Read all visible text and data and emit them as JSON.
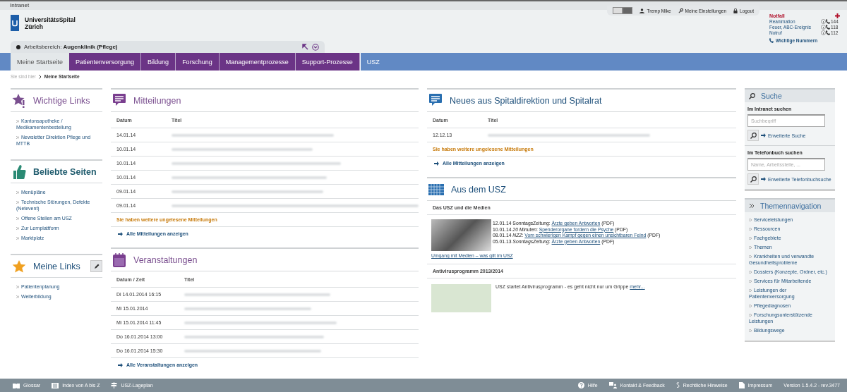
{
  "window": {
    "title": "Intranet"
  },
  "logo": {
    "line1": "UniversitätsSpital",
    "line2": "Zürich"
  },
  "workspace": {
    "label": "Arbeitsbereich:",
    "value": "Augenklinik (Pflege)"
  },
  "view_toggle": [
    {
      "selected": false
    },
    {
      "selected": true
    }
  ],
  "user_menu": [
    {
      "kind": "user",
      "label": "Tremp Mike"
    },
    {
      "kind": "settings",
      "label": "Meine Einstellungen"
    },
    {
      "kind": "logout",
      "label": "Logout"
    }
  ],
  "emergency": {
    "title": "Notfall",
    "items": [
      {
        "label": "Reanimation",
        "number": "144"
      },
      {
        "label": "Feuer, ABC-Ereignis",
        "number": "118"
      },
      {
        "label": "Notruf",
        "number": "112"
      }
    ],
    "link": "Wichtige Nummern"
  },
  "nav": [
    {
      "label": "Meine Startseite",
      "kind": "home",
      "selected": true
    },
    {
      "label": "Patientenversorgung",
      "kind": "process",
      "selected": false
    },
    {
      "label": "Bildung",
      "kind": "process",
      "selected": false
    },
    {
      "label": "Forschung",
      "kind": "process",
      "selected": false
    },
    {
      "label": "Managementprozesse",
      "kind": "process",
      "selected": false
    },
    {
      "label": "Support-Prozesse",
      "kind": "process",
      "selected": false
    },
    {
      "label": "USZ",
      "kind": "org",
      "selected": false
    }
  ],
  "breadcrumb": {
    "label": "Sie sind hier",
    "current": "Meine Startseite"
  },
  "link_boxes": [
    {
      "kind": "important",
      "title": "Wichtige Links",
      "links": [
        "Kantonsapotheke / Medikamentenbestellung",
        "Newsletter Direktion Pflege und MTTB"
      ]
    },
    {
      "kind": "popular",
      "title": "Beliebte Seiten",
      "links": [
        "Menüpläne",
        "Technische Störungen, Defekte (Netevent)",
        "Offene Stellen am USZ",
        "Zur Lernplattform",
        "Marktplatz"
      ]
    },
    {
      "kind": "mine",
      "title": "Meine Links",
      "links": [
        "Patientenplanung",
        "Weiterbildung"
      ]
    }
  ],
  "mitteilungen": {
    "title": "Mitteilungen",
    "columns": [
      "Datum",
      "Titel"
    ],
    "rows": [
      {
        "date": "14.01.14"
      },
      {
        "date": "10.01.14"
      },
      {
        "date": "10.01.14"
      },
      {
        "date": "10.01.14"
      },
      {
        "date": "09.01.14"
      },
      {
        "date": "09.01.14"
      }
    ],
    "notice": "Sie haben weitere ungelesene Mitteilungen",
    "all_link": "Alle Mitteilungen anzeigen"
  },
  "veranstaltungen": {
    "title": "Veranstaltungen",
    "columns": [
      "Datum / Zeit",
      "Titel"
    ],
    "rows": [
      {
        "date": "Di 14.01.2014 16:15"
      },
      {
        "date": "Mi 15.01.2014"
      },
      {
        "date": "Mi 15.01.2014 11:45"
      },
      {
        "date": "Do 16.01.2014 13:00"
      },
      {
        "date": "Do 16.01.2014 15:30"
      }
    ],
    "all_link": "Alle Veranstaltungen anzeigen"
  },
  "spitaldirektion": {
    "title": "Neues aus Spitaldirektion und Spitalrat",
    "columns": [
      "Datum",
      "Titel"
    ],
    "rows": [
      {
        "date": "12.12.13"
      }
    ],
    "notice": "Sie haben weitere ungelesene Mitteilungen",
    "all_link": "Alle Mitteilungen anzeigen"
  },
  "aus_dem_usz": {
    "title": "Aus dem USZ",
    "media": {
      "heading": "Das USZ und die Medien",
      "items": [
        {
          "date": "12.01.14",
          "source": "SonntagsZeitung:",
          "title": "Ärzte geben Antworten",
          "suffix": "(PDF)"
        },
        {
          "date": "10.01.14",
          "source": "*20 Minuten*:",
          "title": "Spenderorgane fordern die Psyche",
          "suffix": "(PDF)"
        },
        {
          "date": "08.01.14",
          "source": "*NZZ*:",
          "title": "Vom schwierigen Kampf gegen einen unsichtbaren Feind",
          "suffix": "(PDF)"
        },
        {
          "date": "05.01.13",
          "source": "*SonntagsZeitung*:",
          "title": "Ärzte geben Antworten",
          "suffix": "(PDF)"
        }
      ],
      "link": "Umgang mit Medien – was gilt im USZ"
    },
    "antivirus": {
      "heading": "Antivirusprogramm 2013/2014",
      "text": "USZ startet Antivirusprogramm - es geht nicht nur um Grippe",
      "more": "mehr..."
    }
  },
  "search": {
    "title": "Suche",
    "sections": [
      {
        "label": "Im Intranet suchen",
        "placeholder": "Suchbegriff",
        "link": "Erweiterte Suche"
      },
      {
        "label": "Im Telefonbuch suchen",
        "placeholder": "Name, Arbeitsstelle, ...",
        "link": "Erweiterte Telefonbuchsuche"
      }
    ]
  },
  "themen": {
    "title": "Themennavigation",
    "items": [
      "Serviceleistungen",
      "Ressourcen",
      "Fachgebiete",
      "Themen",
      "Krankheiten und verwandte Gesundheitsprobleme",
      "Dossiers (Konzepte, Ordner, etc.)",
      "Services für Mitarbeitende",
      "Leistungen der Patientenversorgung",
      "Pflegediagnosen",
      "Forschungsunterstützende Leistungen",
      "Bildungswege"
    ]
  },
  "footer": {
    "left": [
      {
        "kind": "book",
        "label": "Glossar"
      },
      {
        "kind": "index",
        "label": "Index von A bis Z"
      },
      {
        "kind": "map",
        "label": "USZ-Lageplan"
      }
    ],
    "right": [
      {
        "kind": "help",
        "label": "Hilfe"
      },
      {
        "kind": "feedback",
        "label": "Kontakt & Feedback"
      },
      {
        "kind": "legal",
        "label": "Rechtliche Hinweise"
      },
      {
        "kind": "imprint",
        "label": "Impressum"
      }
    ],
    "version": "Version 1.5.4.2 - rev.3477"
  }
}
